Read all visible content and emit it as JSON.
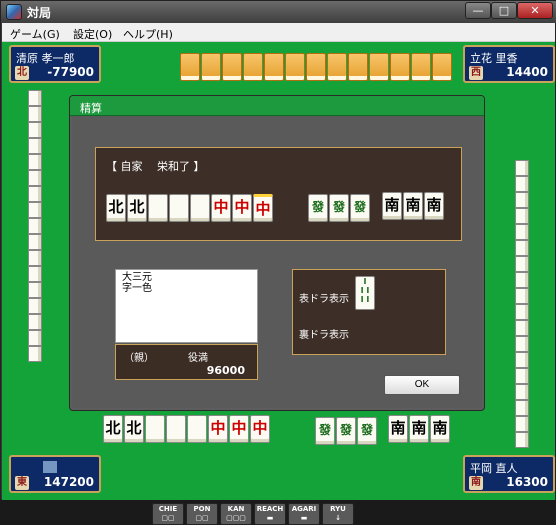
{
  "window": {
    "title": "対局"
  },
  "menu": [
    "ゲーム(G)",
    "設定(O)",
    "ヘルプ(H)"
  ],
  "players": {
    "top_left": {
      "name": "清原 孝一郎",
      "wind": "北",
      "score": "-77900"
    },
    "top_right": {
      "name": "立花 里香",
      "wind": "西",
      "score": "14400"
    },
    "bottom_left": {
      "name": "",
      "wind": "東",
      "score": "147200"
    },
    "bottom_right": {
      "name": "平岡 直人",
      "wind": "南",
      "score": "16300"
    }
  },
  "dialog": {
    "title": "精算",
    "heading": "【 自家　 栄和了 】",
    "hand": [
      "北",
      "北",
      "",
      "",
      "",
      "中",
      "中",
      "中"
    ],
    "meld1": [
      "發",
      "發",
      "發"
    ],
    "meld2": [
      "南",
      "南",
      "南"
    ],
    "yaku": [
      "大三元",
      "字一色"
    ],
    "dealer_label": "（親）",
    "limit_label": "役満",
    "points": "96000",
    "dora_label": "表ドラ表示",
    "ura_label": "裏ドラ表示",
    "ok_label": "OK"
  },
  "bottom_hand": [
    "北",
    "北",
    "",
    "",
    "",
    "中",
    "中",
    "中"
  ],
  "bottom_meld1": [
    "發",
    "發",
    "發"
  ],
  "bottom_meld2": [
    "南",
    "南",
    "南"
  ],
  "actions": [
    "CHIE",
    "PON",
    "KAN",
    "REACH",
    "AGARI",
    "RYU"
  ],
  "colors": {
    "table": "#14a338",
    "panel": "#3d2f28",
    "accent": "#c9a35a",
    "player_bg": "#0d2a66"
  }
}
